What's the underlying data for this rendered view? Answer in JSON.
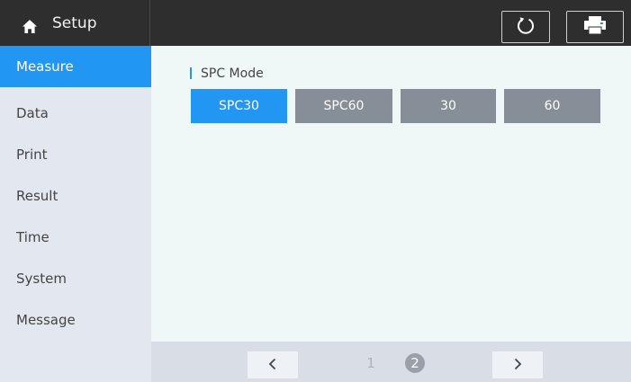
{
  "header": {
    "title": "Setup",
    "icons": {
      "home": "home-icon",
      "reset": "refresh-icon",
      "print": "printer-icon"
    }
  },
  "sidebar": {
    "items": [
      {
        "label": "Measure",
        "active": true
      },
      {
        "label": "Data",
        "active": false
      },
      {
        "label": "Print",
        "active": false
      },
      {
        "label": "Result",
        "active": false
      },
      {
        "label": "Time",
        "active": false
      },
      {
        "label": "System",
        "active": false
      },
      {
        "label": "Message",
        "active": false
      }
    ]
  },
  "main": {
    "section_title": "SPC Mode",
    "options": [
      {
        "label": "SPC30",
        "selected": true
      },
      {
        "label": "SPC60",
        "selected": false
      },
      {
        "label": "30",
        "selected": false
      },
      {
        "label": "60",
        "selected": false
      }
    ]
  },
  "pagination": {
    "prev_icon": "chevron-left-icon",
    "next_icon": "chevron-right-icon",
    "pages": [
      "1",
      "2"
    ],
    "current_page": "2"
  },
  "colors": {
    "accent": "#2196f3",
    "topbar": "#2e2e2e",
    "sidebar": "#e3e8f0",
    "option_inactive": "#868f97",
    "content_bg": "#f0f7f7"
  }
}
